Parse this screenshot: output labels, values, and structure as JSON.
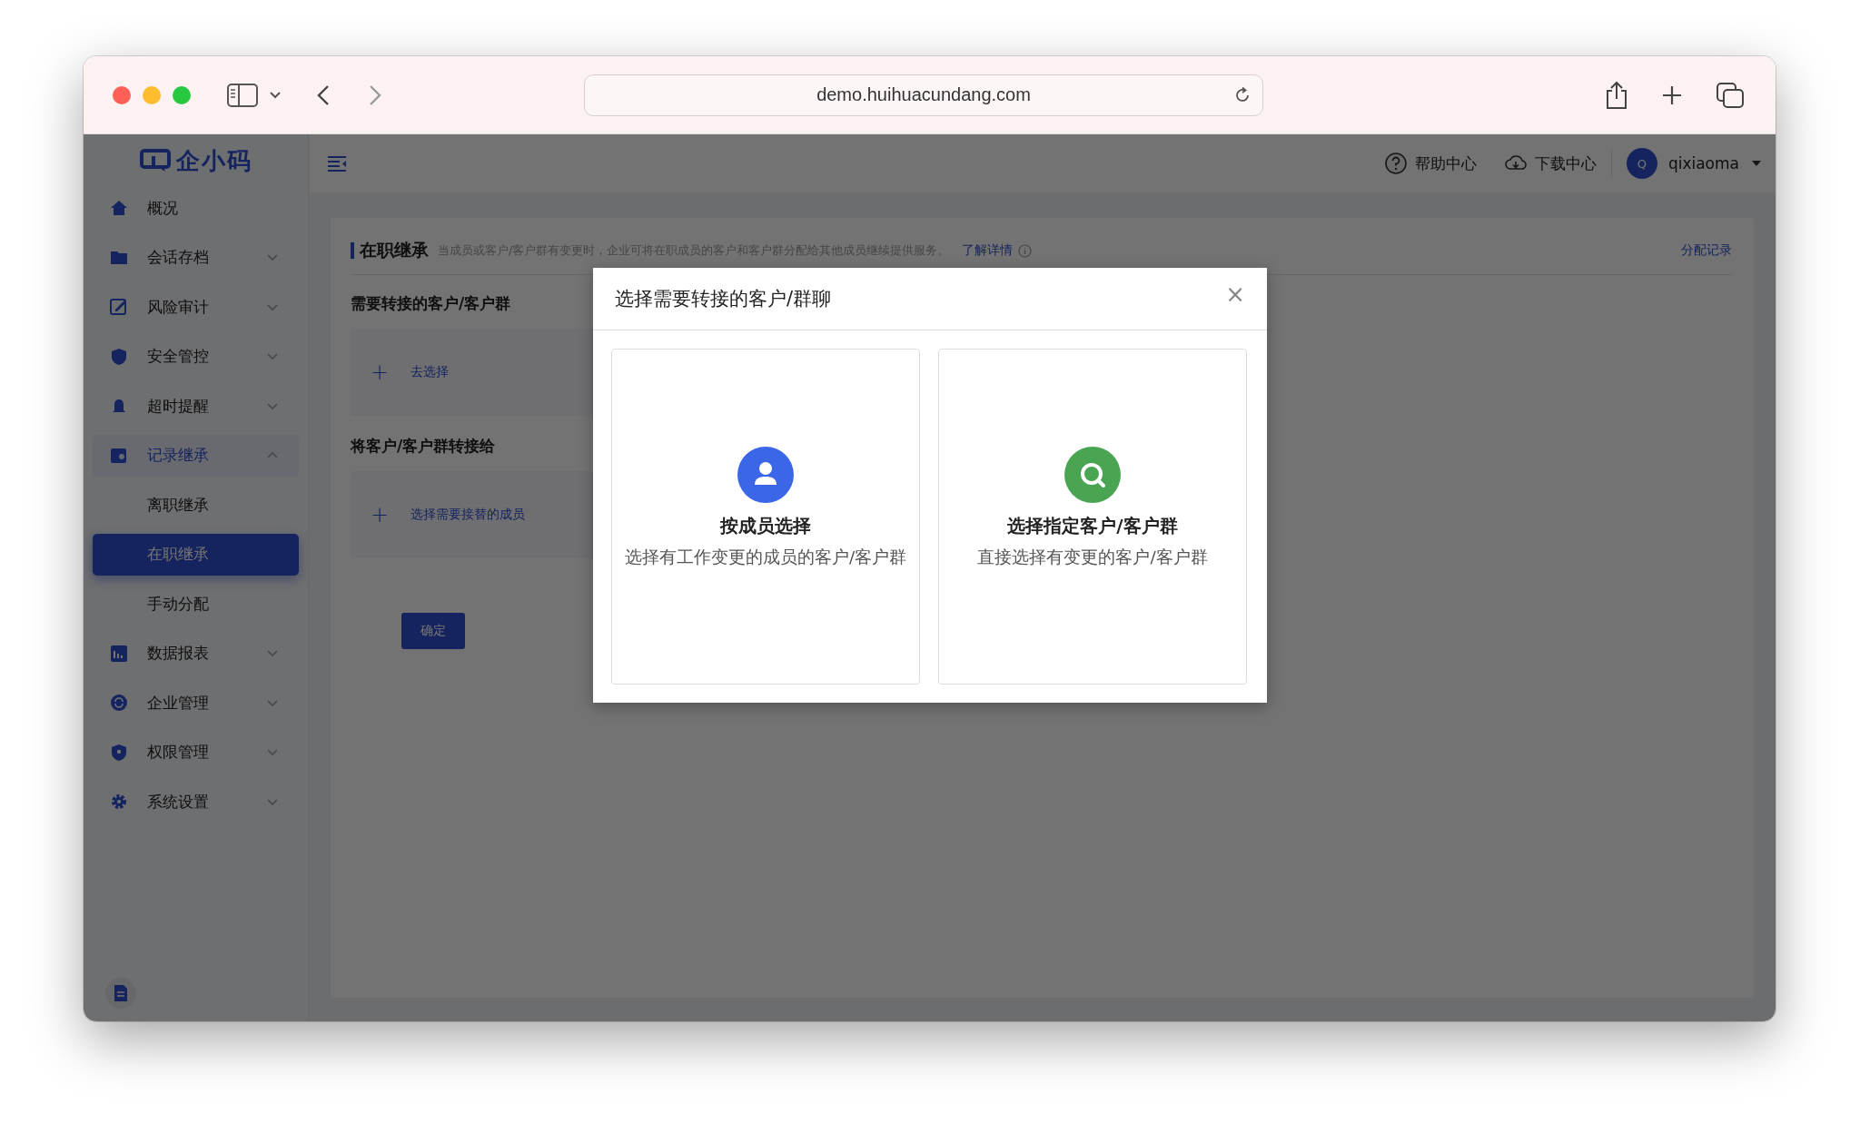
{
  "browser": {
    "url": "demo.huihuacundang.com"
  },
  "sidebar": {
    "logo": "企小码",
    "items": [
      {
        "label": "概况",
        "selected": false
      },
      {
        "label": "会话存档",
        "expanded": false,
        "selected": false
      },
      {
        "label": "风险审计",
        "expanded": false,
        "selected": false
      },
      {
        "label": "安全管控",
        "expanded": false,
        "selected": false
      },
      {
        "label": "超时提醒",
        "expanded": false,
        "selected": false
      },
      {
        "label": "记录继承",
        "expanded": true,
        "selected": false,
        "children": [
          {
            "label": "离职继承",
            "selected": false
          },
          {
            "label": "在职继承",
            "selected": true
          },
          {
            "label": "手动分配",
            "selected": false
          }
        ]
      },
      {
        "label": "数据报表",
        "expanded": false,
        "selected": false
      },
      {
        "label": "企业管理",
        "expanded": false,
        "selected": false
      },
      {
        "label": "权限管理",
        "expanded": false,
        "selected": false
      },
      {
        "label": "系统设置",
        "expanded": false,
        "selected": false
      }
    ]
  },
  "header": {
    "help": "帮助中心",
    "download": "下载中心",
    "avatar": "Q",
    "user": "qixiaoma"
  },
  "page": {
    "title": "在职继承",
    "description": "当成员或客户/客户群有变更时，企业可将在职成员的客户和客户群分配给其他成员继续提供服务。",
    "learn_more": "了解详情",
    "records_link": "分配记录",
    "sections": [
      {
        "label": "需要转接的客户/客户群",
        "plus": "+",
        "action": "去选择"
      },
      {
        "label": "将客户/客户群转接给",
        "plus": "+",
        "action": "选择需要接替的成员"
      }
    ],
    "confirm": "确定"
  },
  "modal": {
    "title": "选择需要转接的客户/群聊",
    "close": "×",
    "options": [
      {
        "kind": "member",
        "title": "按成员选择",
        "description": "选择有工作变更的成员的客户/客户群"
      },
      {
        "kind": "customer",
        "title": "选择指定客户/客户群",
        "description": "直接选择有变更的客户/客户群"
      }
    ]
  }
}
